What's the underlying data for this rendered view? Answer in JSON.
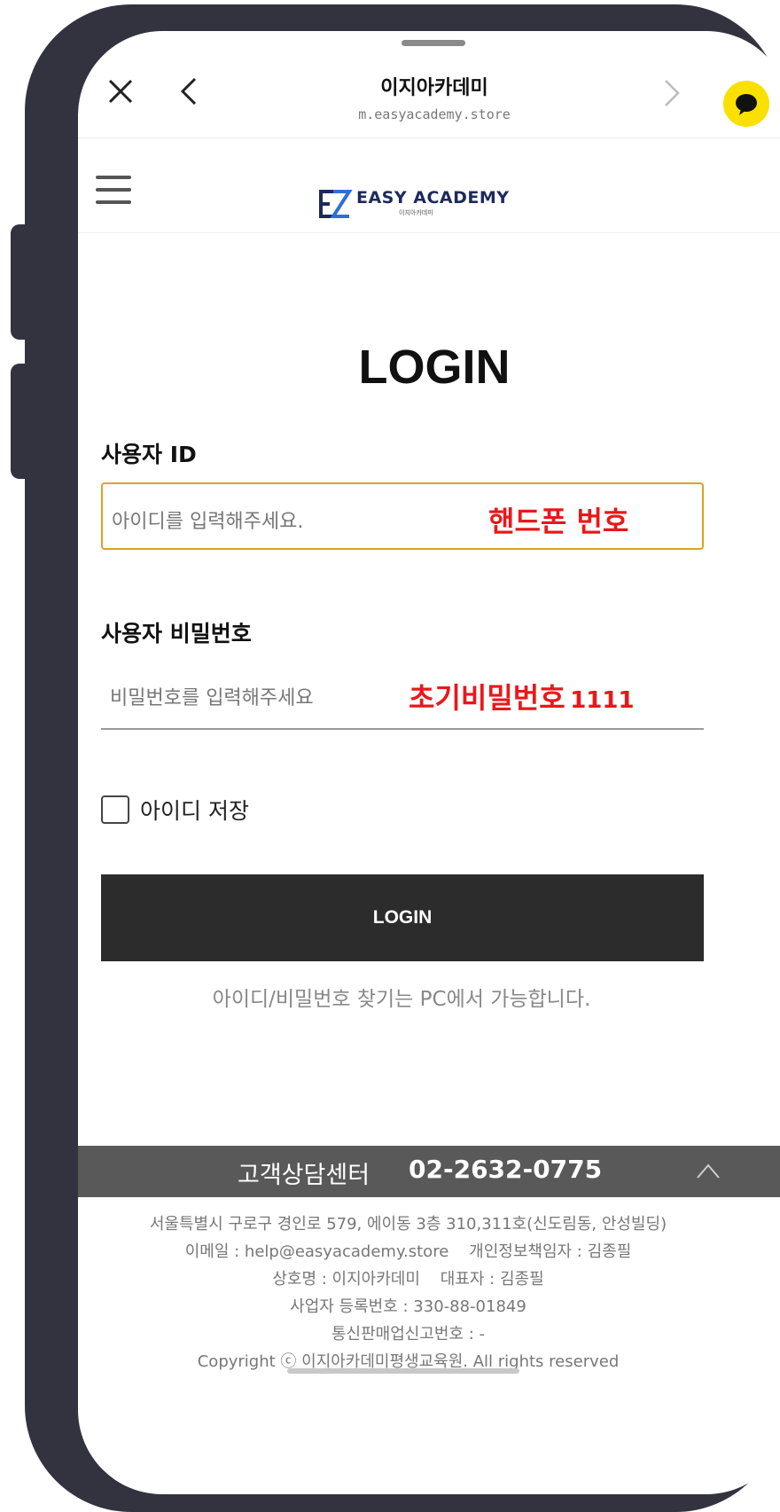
{
  "browser": {
    "title": "이지아카데미",
    "url": "m.easyacademy.store"
  },
  "header": {
    "logo_text": "EASY ACADEMY",
    "logo_sub": "이지아카데미"
  },
  "login": {
    "title": "LOGIN",
    "id_label": "사용자 ID",
    "id_placeholder": "아이디를 입력해주세요.",
    "id_note": "핸드폰 번호",
    "pw_label": "사용자 비밀번호",
    "pw_placeholder": "비밀번호를 입력해주세요",
    "pw_note_text": "초기비밀번호",
    "pw_note_number": "1111",
    "remember_label": "아이디 저장",
    "button_label": "LOGIN",
    "find_text": "아이디/비밀번호 찾기는 PC에서 가능합니다."
  },
  "customer_center": {
    "label": "고객상담센터",
    "phone": "02-2632-0775"
  },
  "footer": {
    "address": "서울특별시 구로구 경인로 579, 에이동 3층 310,311호(신도림동, 안성빌딩)",
    "email_line": "이메일 : help@easyacademy.store    개인정보책임자 : 김종필",
    "company_line": "상호명 : 이지아카데미    대표자 : 김종필",
    "business_no": "사업자 등록번호 : 330-88-01849",
    "mail_order_no": "통신판매업신고번호 : -",
    "copyright": "Copyright ⓒ 이지아카데미평생교육원. All rights reserved"
  },
  "colors": {
    "accent_input_border": "#e0a020",
    "note_red": "#e8181a",
    "kakao_yellow": "#f9e000",
    "button_dark": "#2c2c2c",
    "cs_bar": "#595959"
  },
  "icons": [
    "close-icon",
    "back-arrow-icon",
    "forward-arrow-icon",
    "kakao-chat-icon",
    "hamburger-menu-icon",
    "chevron-up-icon"
  ]
}
